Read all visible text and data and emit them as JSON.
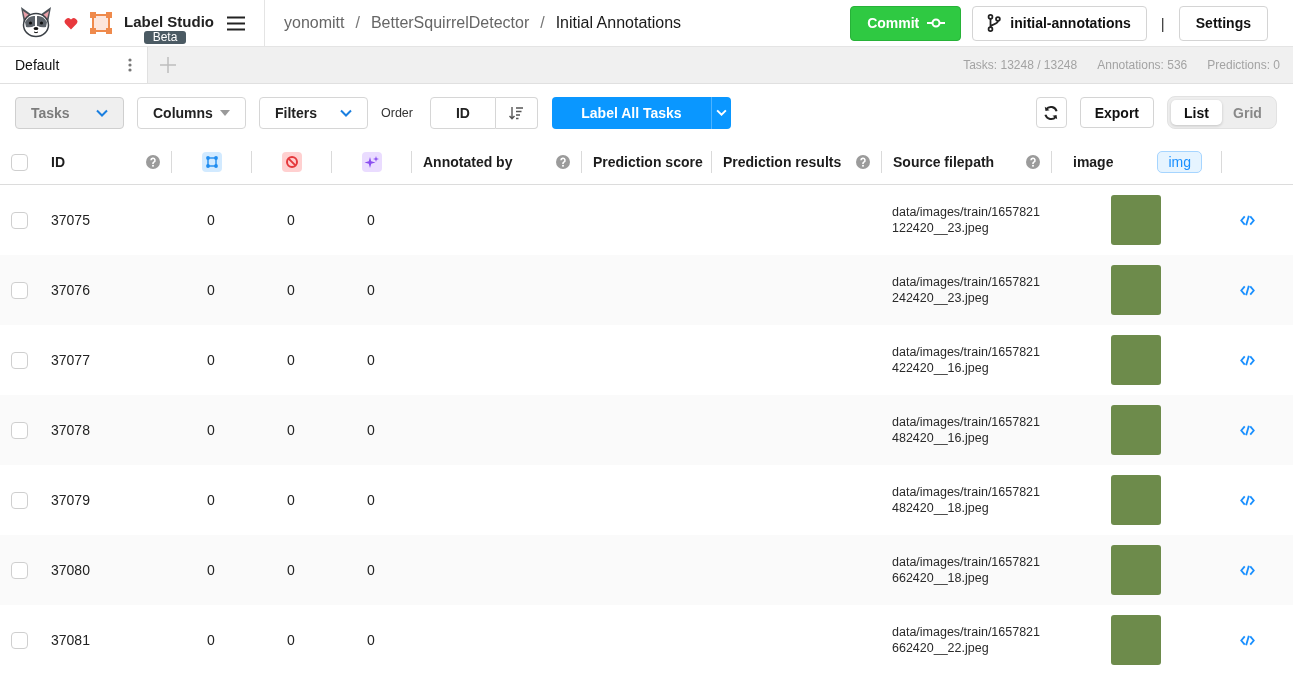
{
  "header": {
    "app_name": "Label Studio",
    "badge": "Beta",
    "breadcrumb": [
      {
        "kind": "link",
        "text": "yonomitt"
      },
      {
        "kind": "separator",
        "text": "/"
      },
      {
        "kind": "link",
        "text": "BetterSquirrelDetector"
      },
      {
        "kind": "separator",
        "text": "/"
      },
      {
        "kind": "current",
        "text": "Initial Annotations"
      }
    ],
    "commit_button": "Commit",
    "branch_button": "initial-annotations",
    "divider": "|",
    "settings_button": "Settings"
  },
  "tabs": [
    {
      "label": "Default",
      "selected": true
    }
  ],
  "stats": [
    "Tasks: 13248 / 13248",
    "Annotations: 536",
    "Predictions: 0"
  ],
  "toolbar": {
    "tasks_dropdown": {
      "label": "Tasks",
      "disabled": true
    },
    "columns_dropdown": "Columns",
    "filters_dropdown": "Filters",
    "order_label": "Order",
    "order_field": "ID",
    "label_button": "Label All Tasks",
    "export_button": "Export",
    "view_toggle": [
      {
        "label": "List",
        "selected": true
      },
      {
        "label": "Grid",
        "selected": false
      }
    ]
  },
  "table": {
    "columns": [
      {
        "kind": "select",
        "checked": false
      },
      {
        "kind": "text",
        "label": "ID",
        "help": true
      },
      {
        "kind": "annotations"
      },
      {
        "kind": "cancelled"
      },
      {
        "kind": "predictions"
      },
      {
        "kind": "text",
        "label": "Annotated by",
        "help": true
      },
      {
        "kind": "text",
        "label": "Prediction score",
        "help": false
      },
      {
        "kind": "text",
        "label": "Prediction results",
        "help": true
      },
      {
        "kind": "text",
        "label": "Source filepath",
        "help": true
      },
      {
        "kind": "data",
        "label": "image",
        "badge": "img"
      }
    ],
    "rows": [
      {
        "id": "37075",
        "selected": false,
        "annotations": "0",
        "cancelled": "0",
        "predictions": "0",
        "source_filepath": "data/images/train/1657821122420__23.jpeg"
      },
      {
        "id": "37076",
        "selected": false,
        "annotations": "0",
        "cancelled": "0",
        "predictions": "0",
        "source_filepath": "data/images/train/1657821242420__23.jpeg"
      },
      {
        "id": "37077",
        "selected": false,
        "annotations": "0",
        "cancelled": "0",
        "predictions": "0",
        "source_filepath": "data/images/train/1657821422420__16.jpeg"
      },
      {
        "id": "37078",
        "selected": false,
        "annotations": "0",
        "cancelled": "0",
        "predictions": "0",
        "source_filepath": "data/images/train/1657821482420__16.jpeg"
      },
      {
        "id": "37079",
        "selected": false,
        "annotations": "0",
        "cancelled": "0",
        "predictions": "0",
        "source_filepath": "data/images/train/1657821482420__18.jpeg"
      },
      {
        "id": "37080",
        "selected": false,
        "annotations": "0",
        "cancelled": "0",
        "predictions": "0",
        "source_filepath": "data/images/train/1657821662420__18.jpeg"
      },
      {
        "id": "37081",
        "selected": false,
        "annotations": "0",
        "cancelled": "0",
        "predictions": "0",
        "source_filepath": "data/images/train/1657821662420__22.jpeg"
      }
    ]
  }
}
